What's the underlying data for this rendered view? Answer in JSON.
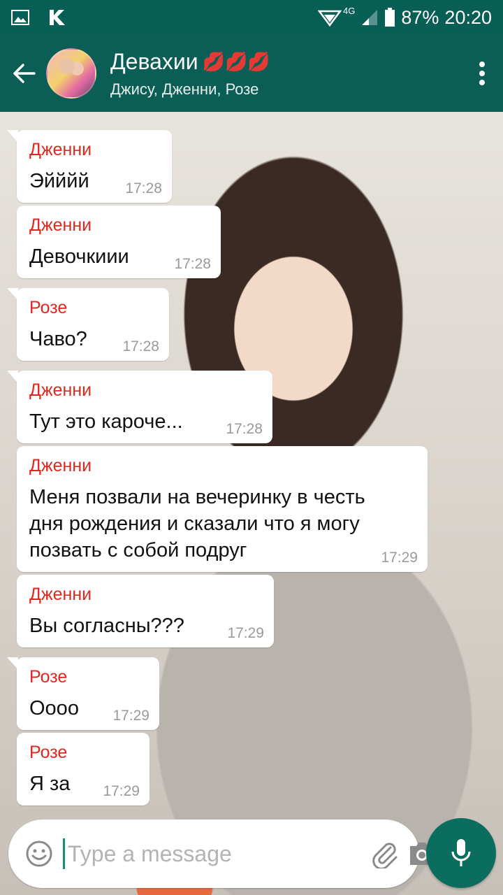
{
  "status": {
    "network_label": "4G",
    "battery": "87%",
    "time": "20:20"
  },
  "chat": {
    "title": "Девахии",
    "title_emoji": "💋💋💋",
    "members": "Джису, Дженни, Розе"
  },
  "messages": [
    {
      "sender": "Дженни",
      "text": "Эйййй",
      "time": "17:28"
    },
    {
      "sender": "Дженни",
      "text": "Девочкиии",
      "time": "17:28"
    },
    {
      "sender": "Розе",
      "text": "Чаво?",
      "time": "17:28"
    },
    {
      "sender": "Дженни",
      "text": "Тут это кароче...",
      "time": "17:28"
    },
    {
      "sender": "Дженни",
      "text": "Меня позвали на вечеринку в честь дня рождения и сказали что я могу позвать с собой подруг",
      "time": "17:29"
    },
    {
      "sender": "Дженни",
      "text": "Вы согласны???",
      "time": "17:29"
    },
    {
      "sender": "Розе",
      "text": "Оооо",
      "time": "17:29"
    },
    {
      "sender": "Розе",
      "text": "Я за",
      "time": "17:29"
    }
  ],
  "composer": {
    "placeholder": "Type a message"
  },
  "colors": {
    "header": "#075e54",
    "sender_name": "#e0281f",
    "mic_button": "#0b6d5f"
  },
  "icons": [
    "image-icon",
    "k-app-icon",
    "wifi-icon",
    "signal-icon",
    "battery-icon",
    "back-arrow-icon",
    "more-vert-icon",
    "emoji-icon",
    "paperclip-icon",
    "camera-icon",
    "microphone-icon"
  ]
}
